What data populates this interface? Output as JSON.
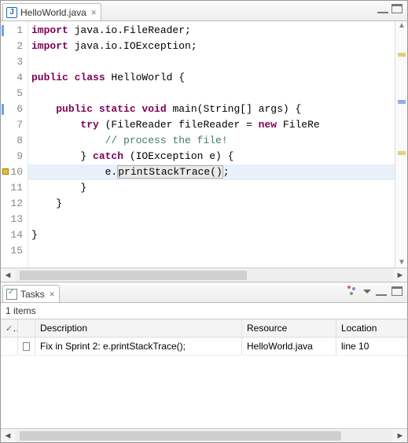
{
  "editor": {
    "tab": {
      "label": "HelloWorld.java"
    },
    "lines": [
      {
        "n": 1,
        "mark": "blue",
        "segments": [
          [
            "kw",
            "import"
          ],
          [
            "id",
            " java.io.FileReader;"
          ]
        ]
      },
      {
        "n": 2,
        "segments": [
          [
            "kw",
            "import"
          ],
          [
            "id",
            " java.io.IOException;"
          ]
        ]
      },
      {
        "n": 3,
        "segments": [
          [
            "id",
            ""
          ]
        ]
      },
      {
        "n": 4,
        "segments": [
          [
            "kw",
            "public class"
          ],
          [
            "id",
            " HelloWorld {"
          ]
        ]
      },
      {
        "n": 5,
        "segments": [
          [
            "id",
            ""
          ]
        ]
      },
      {
        "n": 6,
        "mark": "blue",
        "segments": [
          [
            "id",
            "    "
          ],
          [
            "kw",
            "public static void"
          ],
          [
            "id",
            " main(String[] args) {"
          ]
        ]
      },
      {
        "n": 7,
        "segments": [
          [
            "id",
            "        "
          ],
          [
            "kw",
            "try"
          ],
          [
            "id",
            " (FileReader "
          ],
          [
            "id",
            "fileReader"
          ],
          [
            "id",
            " = "
          ],
          [
            "kw",
            "new "
          ],
          [
            "id",
            "FileRe"
          ]
        ]
      },
      {
        "n": 8,
        "segments": [
          [
            "id",
            "            "
          ],
          [
            "cmt",
            "// process the file!"
          ]
        ]
      },
      {
        "n": 9,
        "segments": [
          [
            "id",
            "        } "
          ],
          [
            "kw",
            "catch"
          ],
          [
            "id",
            " (IOException e) {"
          ]
        ]
      },
      {
        "n": 10,
        "mark": "warn",
        "hl": true,
        "segments": [
          [
            "id",
            "            e."
          ],
          [
            "warn",
            "printStackTrace()"
          ],
          [
            "id",
            ";"
          ]
        ]
      },
      {
        "n": 11,
        "segments": [
          [
            "id",
            "        }"
          ]
        ]
      },
      {
        "n": 12,
        "segments": [
          [
            "id",
            "    }"
          ]
        ]
      },
      {
        "n": 13,
        "segments": [
          [
            "id",
            ""
          ]
        ]
      },
      {
        "n": 14,
        "segments": [
          [
            "id",
            "}"
          ]
        ]
      },
      {
        "n": 15,
        "segments": [
          [
            "id",
            ""
          ]
        ]
      }
    ]
  },
  "tasks": {
    "tab_label": "Tasks",
    "count_label": "1 items",
    "columns": {
      "complete": "✓",
      "description": "Description",
      "resource": "Resource",
      "location": "Location"
    },
    "rows": [
      {
        "completed": false,
        "description": "Fix in Sprint 2: e.printStackTrace();",
        "resource": "HelloWorld.java",
        "location": "line 10"
      }
    ]
  }
}
